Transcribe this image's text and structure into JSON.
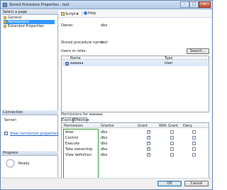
{
  "window": {
    "title": "Stored Procedure Properties - test"
  },
  "leftpane": {
    "select_page_header": "Select a page",
    "pages": [
      {
        "label": "General",
        "selected": false
      },
      {
        "label": "Permissions",
        "selected": true
      },
      {
        "label": "Extended Properties",
        "selected": false
      }
    ],
    "connection_header": "Connection",
    "server_label": "Server:",
    "connection_link": "View connection properties",
    "progress_header": "Progress",
    "progress_status": "Ready"
  },
  "toolbar": {
    "script_label": "Script",
    "help_label": "Help"
  },
  "main": {
    "owner_label": "Owner:",
    "owner_value": "dbo",
    "sp_name_label": "Stored procedure name:",
    "sp_name_value": "test",
    "users_label": "Users or roles:",
    "search_button": "Search...",
    "users_columns": [
      "Name",
      "Type"
    ],
    "users_rows": [
      {
        "name": "aaaaaa",
        "type": "User"
      }
    ],
    "permissions_for_label": "Permissions for aaaaaa:",
    "tabs": [
      {
        "label": "Explicit",
        "active": true
      },
      {
        "label": "Effective",
        "active": false
      }
    ],
    "perm_columns": [
      "Permission",
      "Grantor",
      "Grant",
      "With Grant",
      "Deny"
    ],
    "perm_rows": [
      {
        "permission": "Alter",
        "grantor": "dbo",
        "grant": true,
        "with_grant": false,
        "deny": false
      },
      {
        "permission": "Control",
        "grantor": "dbo",
        "grant": true,
        "with_grant": false,
        "deny": false
      },
      {
        "permission": "Execute",
        "grantor": "dbo",
        "grant": true,
        "with_grant": false,
        "deny": false
      },
      {
        "permission": "Take ownership",
        "grantor": "dbo",
        "grant": true,
        "with_grant": false,
        "deny": false
      },
      {
        "permission": "View definition",
        "grantor": "dbo",
        "grant": true,
        "with_grant": false,
        "deny": false
      }
    ]
  },
  "footer": {
    "ok_label": "OK",
    "cancel_label": "Cancel"
  }
}
